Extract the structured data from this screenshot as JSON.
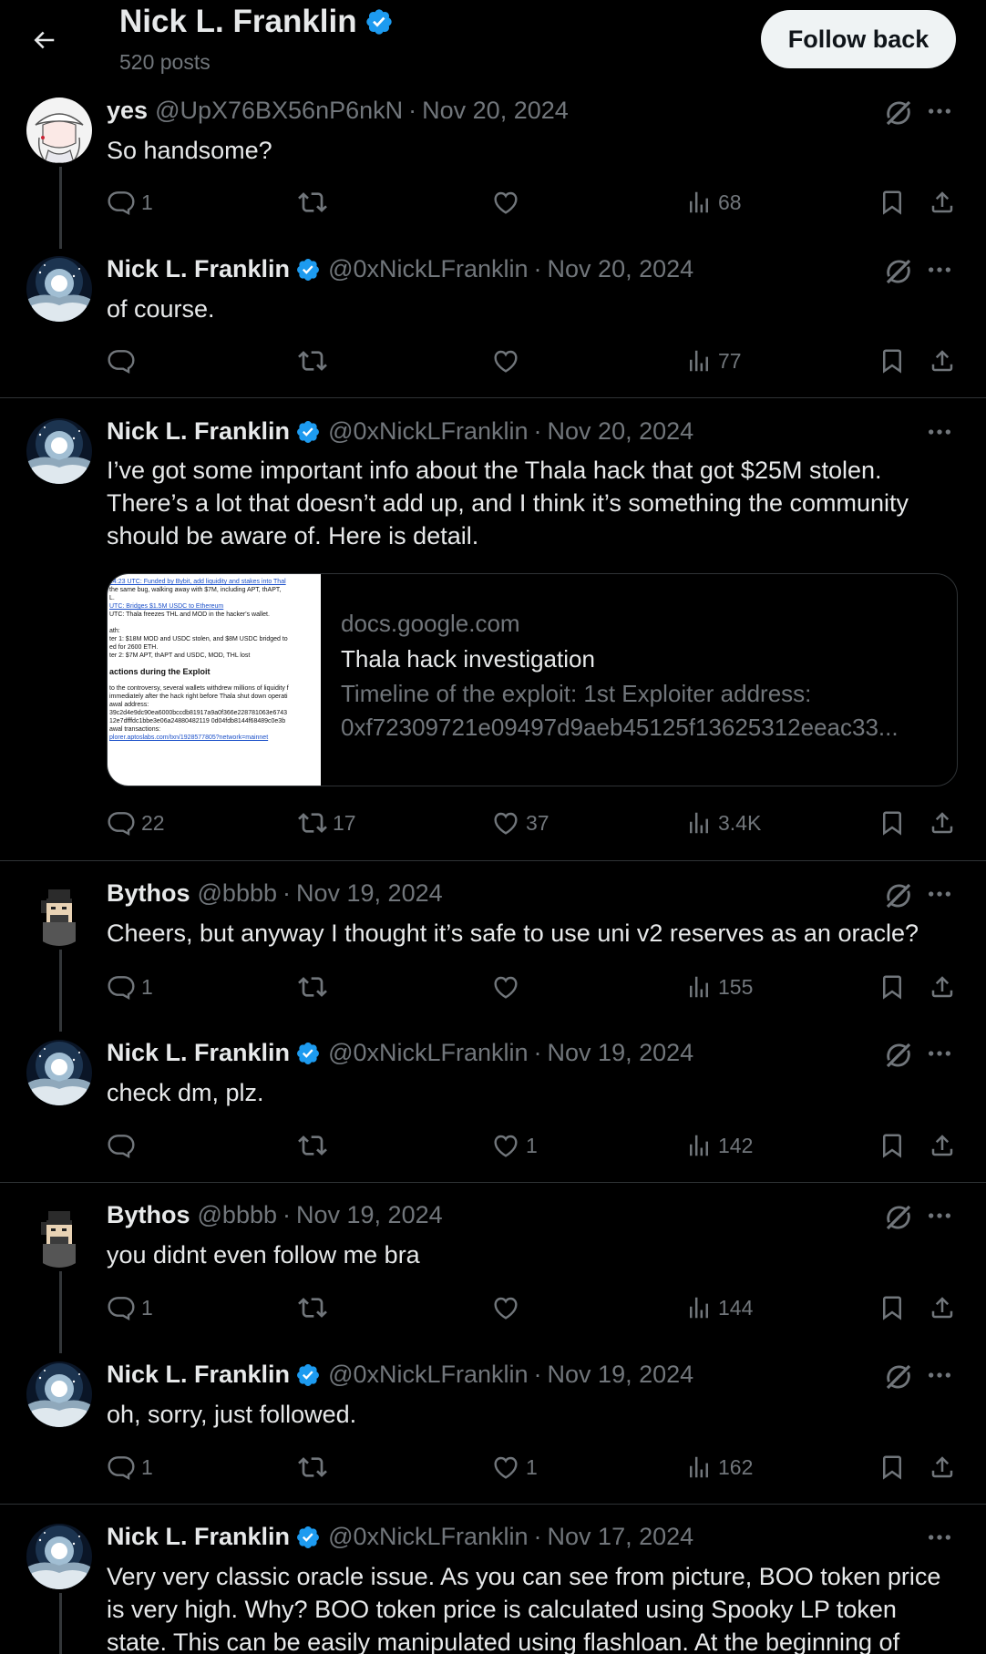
{
  "header": {
    "name": "Nick L. Franklin",
    "post_count": "520 posts",
    "follow_label": "Follow back"
  },
  "tweets": [
    {
      "name": "yes",
      "handle": "@UpX76BX56nP6nkN",
      "date": "Nov 20, 2024",
      "text": "So handsome?",
      "replies": "1",
      "retweets": "",
      "likes": "",
      "views": "68"
    },
    {
      "name": "Nick L. Franklin",
      "handle": "@0xNickLFranklin",
      "date": "Nov 20, 2024",
      "text": "of course.",
      "replies": "",
      "retweets": "",
      "likes": "",
      "views": "77"
    },
    {
      "name": "Nick L. Franklin",
      "handle": "@0xNickLFranklin",
      "date": "Nov 20, 2024",
      "text": "I’ve got some important info about the Thala hack that got $25M stolen. There’s a lot that doesn’t add up, and I think it’s something the community should be aware of. Here is detail.",
      "replies": "22",
      "retweets": "17",
      "likes": "37",
      "views": "3.4K",
      "card": {
        "domain": "docs.google.com",
        "title": "Thala hack investigation",
        "description": "Timeline of the exploit: 1st Exploiter address: 0xf72309721e09497d9aeb45125f13625312eeac33...",
        "thumb_lines": [
          "14:23 UTC: Funded by Bybit, add liquidity and stakes into Thal",
          "the same bug, walking away with $7M, including APT, thAPT,",
          "L.",
          "UTC: Bridges $1.5M USDC to Ethereum",
          "UTC: Thala freezes THL and MOD in the hacker's wallet.",
          "",
          "ath:",
          "ter 1: $18M MOD and USDC stolen, and $8M USDC bridged to",
          "ed for 2600 ETH.",
          "ter 2: $7M APT, thAPT and USDC, MOD, THL lost",
          "",
          "actions during the Exploit",
          "",
          "to the controversy, several wallets withdrew millions of liquidity f",
          "immediately after the hack right before Thala shut down operati",
          "awal address:",
          "39c2d4e9dc90ea6000bccdb81917a9a0f366e228781063e6743",
          "12e7dfffdc1bbe3e06a24880482119 0d04fdb8144f68489c0e3b",
          "awal transactions:",
          "plorer.aptoslabs.com/txn/1928577805?network=mainnet"
        ]
      }
    },
    {
      "name": "Bythos",
      "handle": "@bbbb",
      "date": "Nov 19, 2024",
      "text": "Cheers, but anyway I thought it’s safe to use uni v2 reserves as an oracle?",
      "replies": "1",
      "retweets": "",
      "likes": "",
      "views": "155"
    },
    {
      "name": "Nick L. Franklin",
      "handle": "@0xNickLFranklin",
      "date": "Nov 19, 2024",
      "text": "check dm, plz.",
      "replies": "",
      "retweets": "",
      "likes": "1",
      "views": "142"
    },
    {
      "name": "Bythos",
      "handle": "@bbbb",
      "date": "Nov 19, 2024",
      "text": "you didnt even follow me bra",
      "replies": "1",
      "retweets": "",
      "likes": "",
      "views": "144"
    },
    {
      "name": "Nick L. Franklin",
      "handle": "@0xNickLFranklin",
      "date": "Nov 19, 2024",
      "text": "oh, sorry, just followed.",
      "replies": "1",
      "retweets": "",
      "likes": "1",
      "views": "162"
    },
    {
      "name": "Nick L. Franklin",
      "handle": "@0xNickLFranklin",
      "date": "Nov 17, 2024",
      "text": "Very very classic oracle issue. As you can see from picture, BOO token price is very high. Why? BOO token price is calculated using Spooky LP token state. This can be easily manipulated using flashloan. At the beginning of",
      "replies": "",
      "retweets": "",
      "likes": "",
      "views": ""
    }
  ],
  "colors": {
    "background": "#000000",
    "text": "#e7e9ea",
    "muted": "#71767b",
    "divider": "#2f3336",
    "verified": "#1d9bf0"
  },
  "icons": [
    "back-arrow-icon",
    "verified-badge-icon",
    "grok-icon",
    "more-icon",
    "reply-icon",
    "retweet-icon",
    "like-icon",
    "views-icon",
    "bookmark-icon",
    "share-icon"
  ]
}
